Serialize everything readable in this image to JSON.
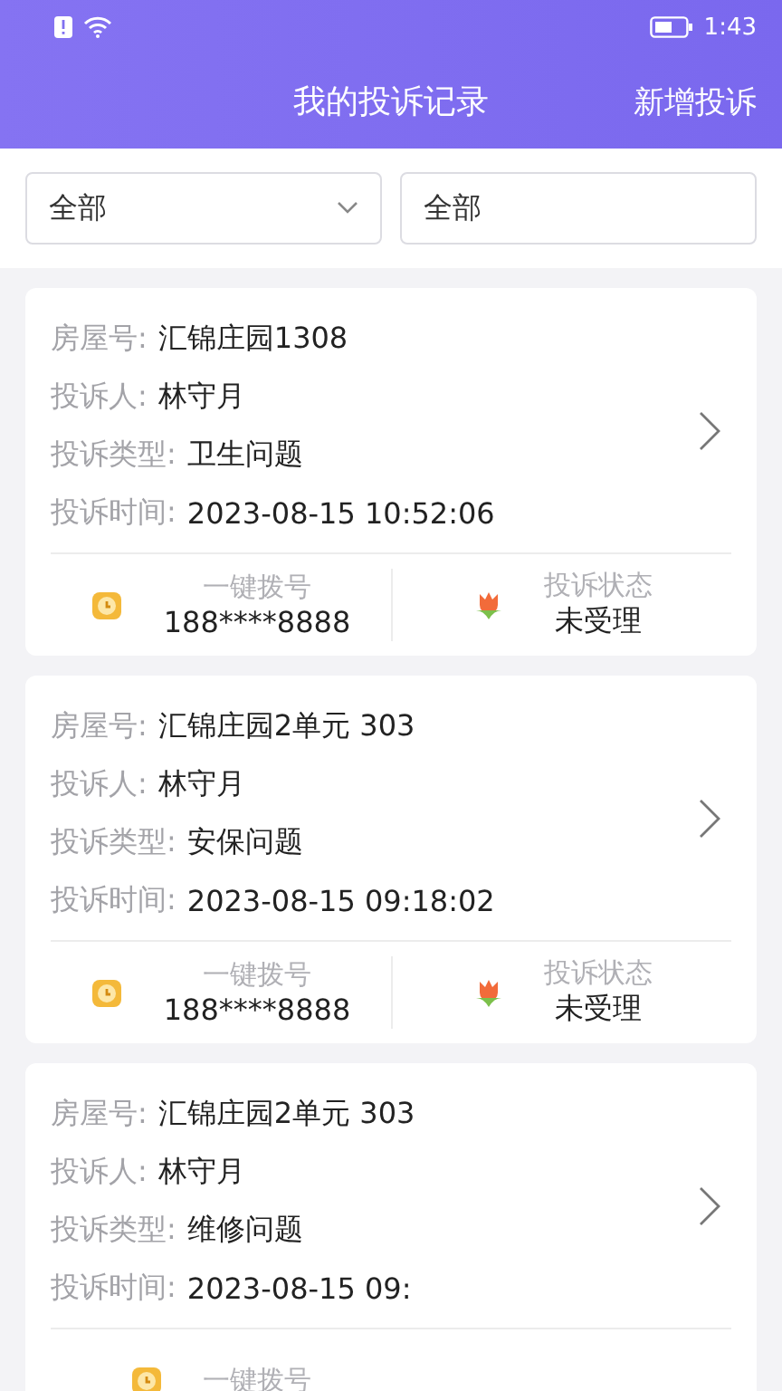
{
  "status_bar": {
    "time": "1:43"
  },
  "header": {
    "title": "我的投诉记录",
    "action": "新增投诉"
  },
  "filters": [
    {
      "value": "全部",
      "kind": "dropdown"
    },
    {
      "value": "全部",
      "kind": "text"
    }
  ],
  "complaints": [
    {
      "fields": [
        {
          "label": "房屋号:",
          "value": "汇锦庄园1308"
        },
        {
          "label": "投诉人:",
          "value": "林守月"
        },
        {
          "label": "投诉类型:",
          "value": "卫生问题"
        },
        {
          "label": "投诉时间:",
          "value": "2023-08-15 10:52:06"
        }
      ],
      "call_label": "一键拨号",
      "phone": "188****8888",
      "status_label": "投诉状态",
      "status": "未受理"
    },
    {
      "fields": [
        {
          "label": "房屋号:",
          "value": "汇锦庄园2单元 303"
        },
        {
          "label": "投诉人:",
          "value": "林守月"
        },
        {
          "label": "投诉类型:",
          "value": "安保问题"
        },
        {
          "label": "投诉时间:",
          "value": "2023-08-15 09:18:02"
        }
      ],
      "call_label": "一键拨号",
      "phone": "188****8888",
      "status_label": "投诉状态",
      "status": "未受理"
    },
    {
      "fields": [
        {
          "label": "房屋号:",
          "value": "汇锦庄园2单元 303"
        },
        {
          "label": "投诉人:",
          "value": "林守月"
        },
        {
          "label": "投诉类型:",
          "value": "维修问题"
        },
        {
          "label": "投诉时间:",
          "value": "2023-08-15 09:"
        }
      ],
      "call_label": "一键拨号"
    }
  ]
}
